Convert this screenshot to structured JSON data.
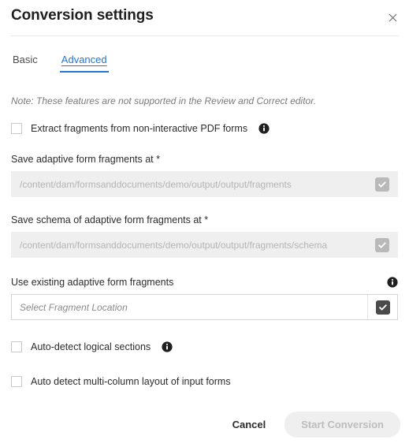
{
  "dialog": {
    "title": "Conversion settings",
    "close_icon": "close-icon"
  },
  "tabs": [
    {
      "label": "Basic",
      "active": false
    },
    {
      "label": "Advanced",
      "active": true
    }
  ],
  "note": "Note: These features are not supported in the Review and Correct editor.",
  "options": {
    "extract_fragments": {
      "label": "Extract fragments from non-interactive PDF forms",
      "checked": false,
      "info_icon": "info-icon"
    },
    "auto_detect_sections": {
      "label": "Auto-detect logical sections",
      "checked": false,
      "info_icon": "info-icon"
    },
    "auto_detect_multicolumn": {
      "label": "Auto detect multi-column layout of input forms",
      "checked": false
    }
  },
  "fields": {
    "fragments_path": {
      "label": "Save adaptive form fragments at *",
      "value": "",
      "placeholder": "/content/dam/formsanddocuments/demo/output/output/fragments",
      "disabled": true,
      "button_icon": "checkmark-icon"
    },
    "schema_path": {
      "label": "Save schema of adaptive form fragments at *",
      "value": "",
      "placeholder": "/content/dam/formsanddocuments/demo/output/output/fragments/schema",
      "disabled": true,
      "button_icon": "checkmark-icon"
    },
    "existing_fragments": {
      "label": "Use existing adaptive form fragments",
      "value": "",
      "placeholder": "Select Fragment Location",
      "disabled": false,
      "info_icon": "info-icon",
      "button_icon": "checkmark-icon"
    }
  },
  "footer": {
    "cancel_label": "Cancel",
    "submit_label": "Start Conversion",
    "submit_disabled": true
  },
  "colors": {
    "accent": "#2176d5",
    "text": "#2c2c2c",
    "muted": "#8c8c8c",
    "disabled_bg": "#efefef"
  }
}
